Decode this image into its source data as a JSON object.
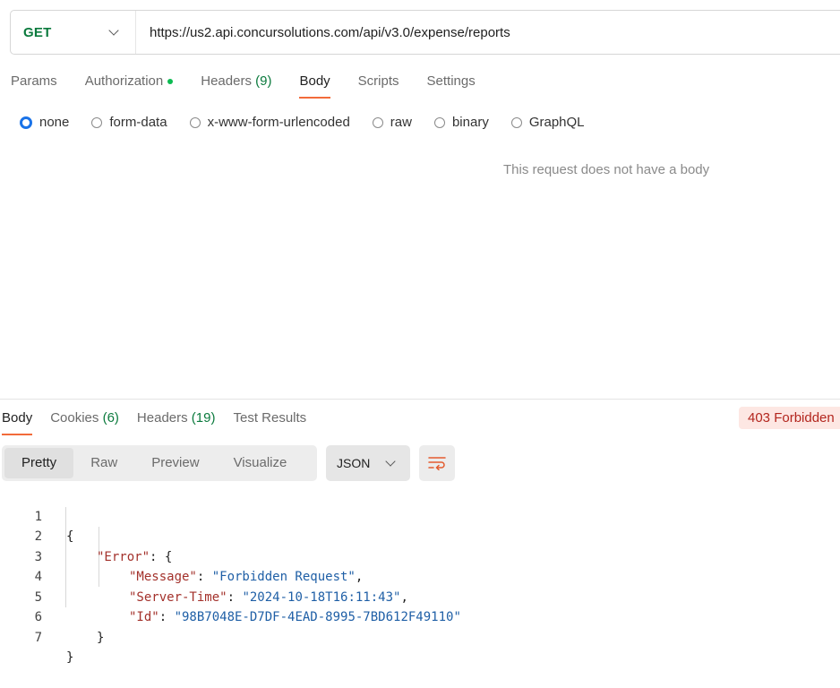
{
  "request": {
    "method": "GET",
    "url": "https://us2.api.concursolutions.com/api/v3.0/expense/reports",
    "tabs": [
      {
        "label": "Params",
        "count": ""
      },
      {
        "label": "Authorization",
        "count": ""
      },
      {
        "label": "Headers",
        "count": "(9)"
      },
      {
        "label": "Body",
        "count": ""
      },
      {
        "label": "Scripts",
        "count": ""
      },
      {
        "label": "Settings",
        "count": ""
      }
    ],
    "body_types": [
      "none",
      "form-data",
      "x-www-form-urlencoded",
      "raw",
      "binary",
      "GraphQL"
    ],
    "selected_body_type": "none",
    "empty_message": "This request does not have a body"
  },
  "response": {
    "tabs": [
      {
        "label": "Body",
        "count": ""
      },
      {
        "label": "Cookies",
        "count": "(6)"
      },
      {
        "label": "Headers",
        "count": "(19)"
      },
      {
        "label": "Test Results",
        "count": ""
      }
    ],
    "status": "403 Forbidden",
    "view_modes": [
      "Pretty",
      "Raw",
      "Preview",
      "Visualize"
    ],
    "active_view": "Pretty",
    "format": "JSON",
    "lines": [
      {
        "num": "1",
        "text": "{"
      },
      {
        "num": "2",
        "key": "\"Error\"",
        "rest": ": {"
      },
      {
        "num": "3",
        "key": "\"Message\"",
        "sep": ": ",
        "val": "\"Forbidden Request\"",
        "tail": ","
      },
      {
        "num": "4",
        "key": "\"Server-Time\"",
        "sep": ": ",
        "val": "\"2024-10-18T16:11:43\"",
        "tail": ","
      },
      {
        "num": "5",
        "key": "\"Id\"",
        "sep": ": ",
        "val": "\"98B7048E-D7DF-4EAD-8995-7BD612F49110\"",
        "tail": ""
      },
      {
        "num": "6",
        "text": "}"
      },
      {
        "num": "7",
        "text": "}"
      }
    ]
  },
  "colors": {
    "accent": "#f26b3a",
    "method_get": "#0b7a3d",
    "error": "#b3261e",
    "radio_selected": "#1a73e8",
    "auth_dot": "#0cbb52"
  }
}
